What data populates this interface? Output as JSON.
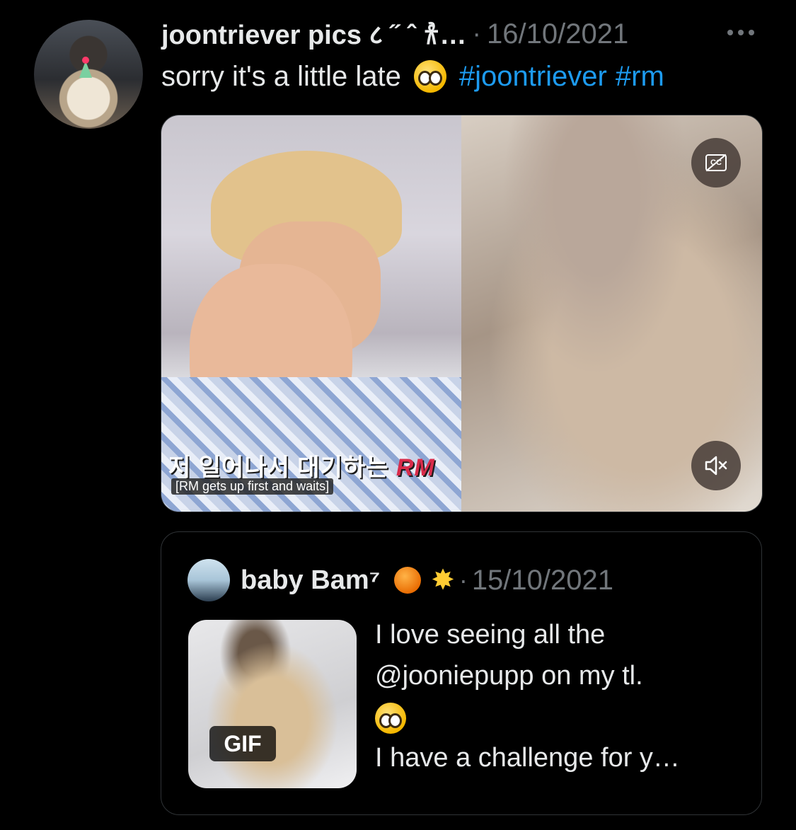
{
  "tweet": {
    "display_name": "joontriever pics ८ ˝ ˆ 𐀪…",
    "separator": "·",
    "date": "16/10/2021",
    "text": "sorry it's a little late",
    "emoji": "pleading-face-emoji",
    "hashtags": [
      "#joontriever",
      "#rm"
    ]
  },
  "media": {
    "caption_korean_prefix": "저 일어나서 대기하는",
    "caption_korean_rm": "RM",
    "caption_english": "[RM gets up first and waits]",
    "captions_icon": "closed-captions-off-icon",
    "mute_icon": "speaker-muted-icon"
  },
  "quote": {
    "display_name": "baby Bam⁷",
    "emojis": [
      "orange-emoji",
      "glowing-star-emoji"
    ],
    "separator": "·",
    "date": "15/10/2021",
    "gif_label": "GIF",
    "text_lines": [
      "I love seeing all the",
      "@jooniepupp on my tl.",
      "",
      "I have a challenge for y…"
    ]
  }
}
